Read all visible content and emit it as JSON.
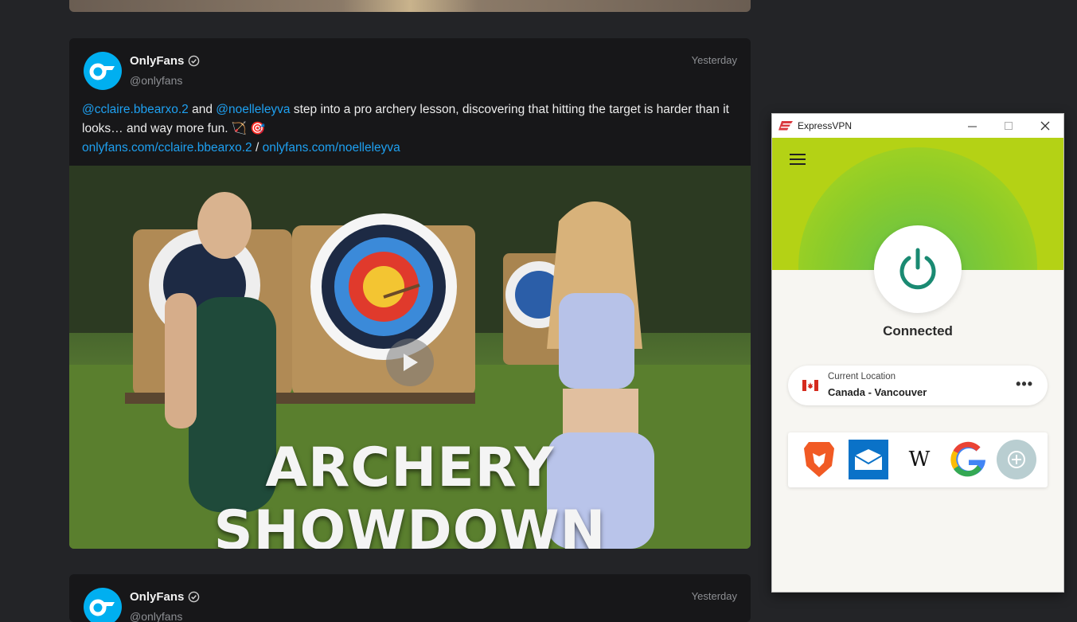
{
  "feed": {
    "posts": [
      {
        "author": "OnlyFans",
        "handle": "@onlyfans",
        "time": "Yesterday",
        "mention1": "@cclaire.bbearxo.2",
        "and": " and ",
        "mention2": "@noelleleyva",
        "text": " step into a pro archery lesson, discovering that hitting the target is harder than it looks… and way more fun. 🏹 🎯",
        "link1": "onlyfans.com/cclaire.bbearxo.2",
        "sep": " / ",
        "link2": "onlyfans.com/noelleleyva",
        "media_title": "ARCHERY SHOWDOWN"
      },
      {
        "author": "OnlyFans",
        "handle": "@onlyfans",
        "time": "Yesterday"
      }
    ]
  },
  "vpn": {
    "title": "ExpressVPN",
    "status": "Connected",
    "location_label": "Current Location",
    "location_value": "Canada - Vancouver",
    "more": "•••",
    "wiki_label": "W",
    "shortcuts": [
      "brave-icon",
      "mail-icon",
      "wikipedia-icon",
      "google-icon",
      "add-shortcut-icon"
    ],
    "accent": "#b4d215",
    "power_color": "#1a8a72"
  },
  "colors": {
    "link": "#1ea0f0",
    "brand": "#00aff0"
  }
}
